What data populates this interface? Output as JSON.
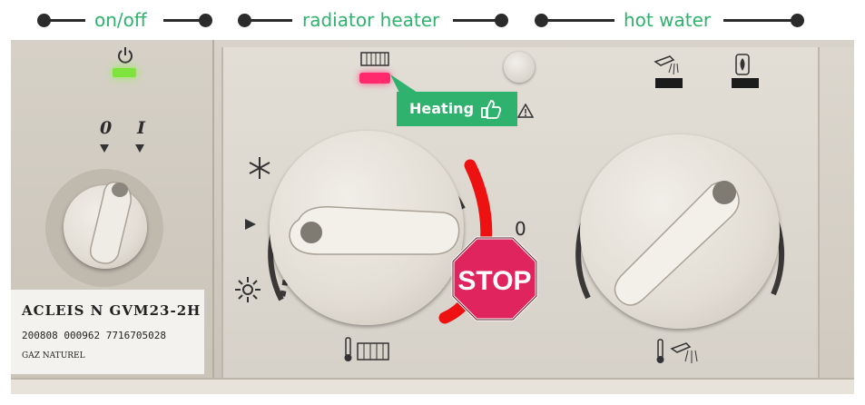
{
  "legend": {
    "on_off": "on/off",
    "radiator_heater": "radiator heater",
    "hot_water": "hot water"
  },
  "panel": {
    "switch_off_mark": "0",
    "switch_on_mark": "I",
    "scale_mark": "0",
    "power_icon": "power-icon",
    "snowflake_icon": "snowflake-icon",
    "sun_icon": "sun-icon",
    "radiator_icon": "radiator-icon",
    "warning_icon": "warning-icon",
    "tap_icon": "tap-icon",
    "flame_icon": "flame-icon",
    "thermometer_icon": "thermometer-icon",
    "led_power_color": "#7ee33d",
    "led_heating_color": "#ff2a6d"
  },
  "label_plate": {
    "model": "ACLEIS N GVM23-2H",
    "serial": "200808 000962 7716705028",
    "gas": "GAZ NATUREL"
  },
  "annotation": {
    "heating": "Heating",
    "stop": "STOP",
    "heating_color": "#2fb26d",
    "stop_color": "#e0245e",
    "arc_color": "#ee1111"
  }
}
